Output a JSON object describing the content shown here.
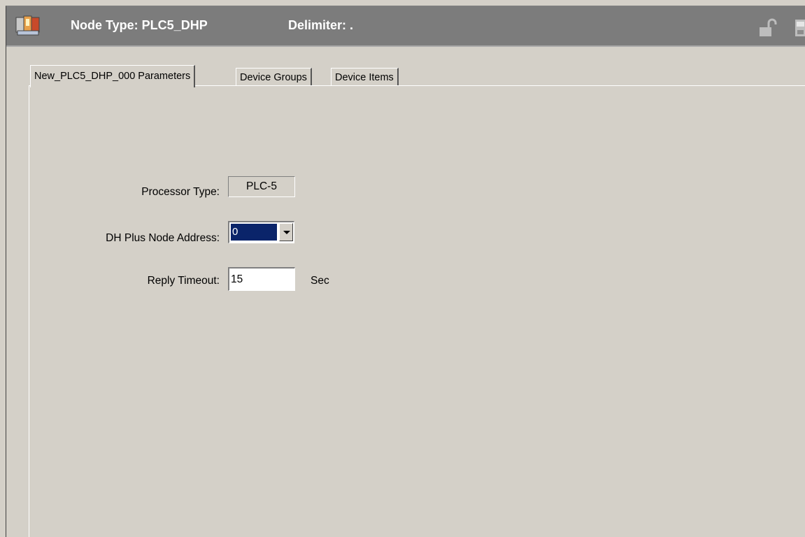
{
  "header": {
    "node_type": "Node Type: PLC5_DHP",
    "delimiter": "Delimiter:  .",
    "icons": [
      "app-icon",
      "lock-icon",
      "save-icon"
    ]
  },
  "tabs": [
    {
      "label": "New_PLC5_DHP_000 Parameters",
      "selected": true
    },
    {
      "label": "Device Groups",
      "selected": false
    },
    {
      "label": "Device Items",
      "selected": false
    }
  ],
  "form": {
    "processor_type": {
      "label": "Processor Type:",
      "value": "PLC-5"
    },
    "dh_plus_node_address": {
      "label": "DH Plus Node Address:",
      "value": "0"
    },
    "reply_timeout": {
      "label": "Reply Timeout:",
      "value": "15",
      "unit": "Sec"
    }
  },
  "colors": {
    "window_bg": "#d4d0c8",
    "header_bg": "#7c7c7c",
    "selection": "#0a246a"
  }
}
